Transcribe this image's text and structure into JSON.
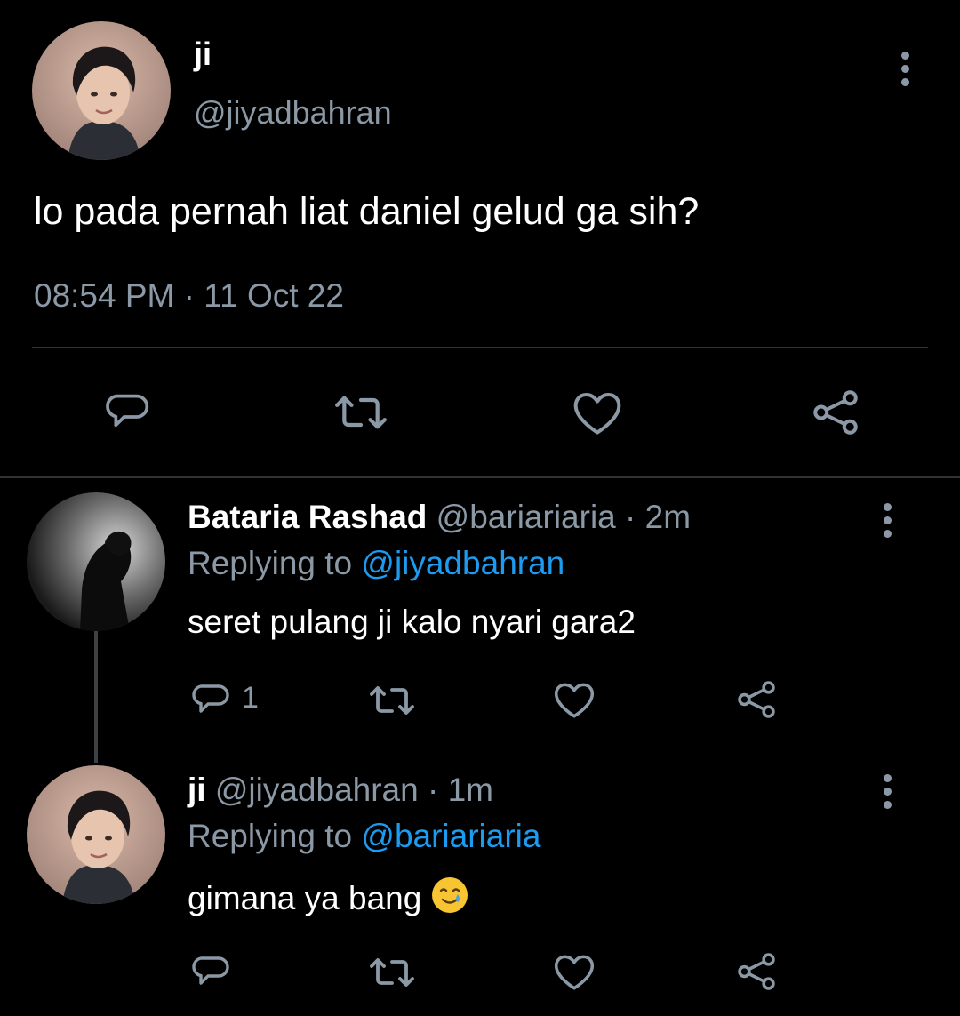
{
  "main_tweet": {
    "name": "ji",
    "handle": "@jiyadbahran",
    "text": "lo pada pernah liat daniel gelud ga sih?",
    "time": "08:54 PM",
    "separator": "·",
    "date": "11 Oct 22"
  },
  "replies": [
    {
      "name": "Bataria Rashad",
      "handle": "@bariariaria",
      "separator": "·",
      "age": "2m",
      "replying_label": "Replying to",
      "replying_to": "@jiyadbahran",
      "text": "seret pulang ji kalo nyari gara2",
      "reply_count": "1"
    },
    {
      "name": "ji",
      "handle": "@jiyadbahran",
      "separator": "·",
      "age": "1m",
      "replying_label": "Replying to",
      "replying_to": "@bariariaria",
      "text": "gimana ya bang",
      "emoji": "smiling-face-with-tear"
    }
  ],
  "icons": [
    "reply-icon",
    "retweet-icon",
    "like-icon",
    "share-icon",
    "more-icon"
  ],
  "colors": {
    "background": "#000000",
    "text": "#ffffff",
    "muted": "#8b98a5",
    "link": "#1d9bf0",
    "divider": "#2f3336"
  }
}
